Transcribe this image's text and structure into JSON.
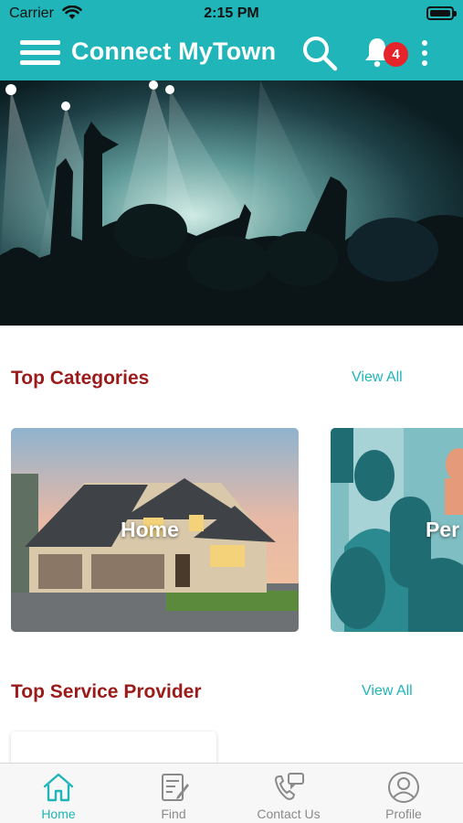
{
  "status_bar": {
    "carrier": "Carrier",
    "time": "2:15 PM"
  },
  "app_bar": {
    "title": "Connect MyTown",
    "notification_count": "4",
    "icons": [
      "menu-icon",
      "search-icon",
      "bell-icon",
      "more-vertical-icon"
    ]
  },
  "hero": {
    "image": "concert-crowd-photo"
  },
  "top_categories": {
    "title": "Top Categories",
    "view_all": "View All",
    "items": [
      {
        "label": "Home",
        "image": "house-photo"
      },
      {
        "label": "Per",
        "image": "people-illustration"
      }
    ]
  },
  "top_service_provider": {
    "title": "Top Service Provider",
    "view_all": "View All"
  },
  "tab_bar": {
    "tabs": [
      {
        "label": "Home",
        "icon": "home-icon",
        "active": true
      },
      {
        "label": "Find",
        "icon": "find-icon",
        "active": false
      },
      {
        "label": "Contact Us",
        "icon": "contact-icon",
        "active": false
      },
      {
        "label": "Profile",
        "icon": "profile-icon",
        "active": false
      }
    ]
  },
  "colors": {
    "primary": "#20b5b8",
    "section_title": "#9b1b1b",
    "badge": "#e5232a",
    "tab_inactive": "#8a8a8a"
  }
}
